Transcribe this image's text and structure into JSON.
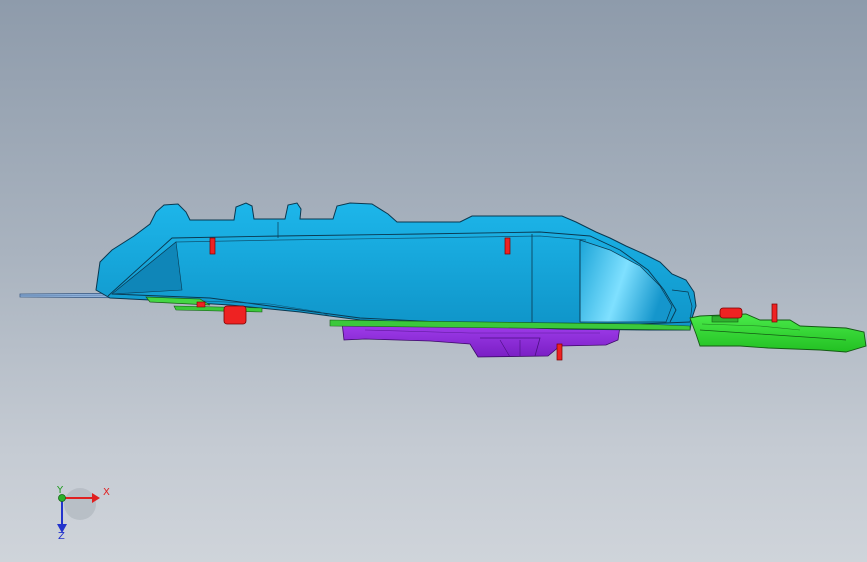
{
  "viewport": {
    "background_top": "#8e9bab",
    "background_bottom": "#cfd4da"
  },
  "model": {
    "parts": [
      {
        "name": "main-housing",
        "color": "#15a9e0"
      },
      {
        "name": "lower-bracket",
        "color": "#9b30e8"
      },
      {
        "name": "end-bracket",
        "color": "#33dd33"
      },
      {
        "name": "mounting-pins",
        "color": "#ee2222"
      },
      {
        "name": "flange-sheet",
        "color": "#7fa6d6"
      }
    ]
  },
  "triad": {
    "x_label": "X",
    "y_label": "Y",
    "z_label": "Z",
    "x_color": "#e02020",
    "y_color": "#1c9a1c",
    "z_color": "#2233cc"
  }
}
